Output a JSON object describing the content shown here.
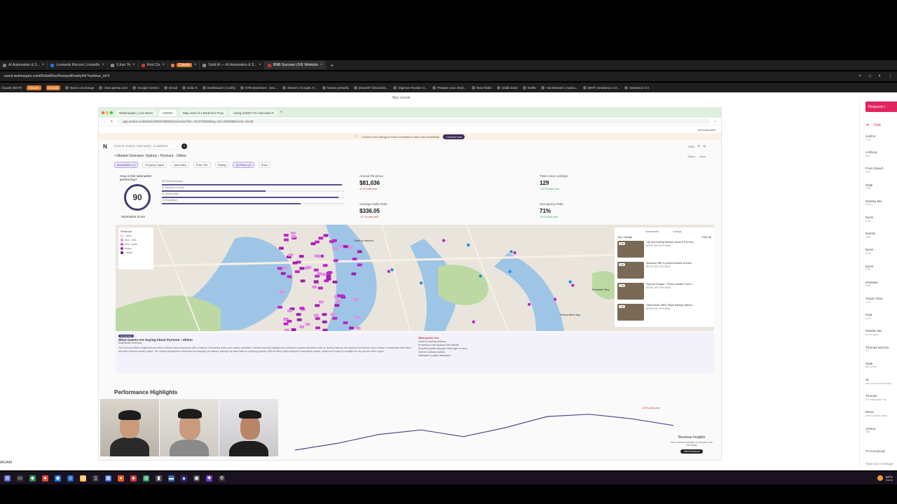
{
  "browser": {
    "tabs": [
      {
        "label": "AI Automation & S...",
        "color": "#7a7a7a"
      },
      {
        "label": "Leonardo Rinconi | LinkedIn",
        "color": "#2a6fd6"
      },
      {
        "label": "S.fran Yo",
        "color": "#888"
      },
      {
        "label": "Kimi Clo",
        "color": "#c0392b"
      },
      {
        "label": "Claude",
        "color": "#e07a2e"
      },
      {
        "label": "Solid AI — AI Automation & S...",
        "color": "#888"
      },
      {
        "label": "BNB Success LIVE Worksho",
        "color": "#c0392b"
      }
    ],
    "url": "event.webinarjam.com/t/ls0w8/live/5mmpx80xwhy/t4r?webinar_id=2",
    "bookmarks": [
      "Claude (MCP)",
      "Claude",
      "Claude",
      "Banco exchange",
      "chat.openai.com",
      "Google Gemini",
      "Gmail",
      "solid AI",
      "Dashboard | Coolify",
      "NTB Machines - Sea...",
      "Stream | Google AI...",
      "Nueva pestaña",
      "lyhack07 (leonardo...",
      "Digimon Rookie Ar...",
      "Prepare your 2022...",
      "New folder",
      "solids track",
      "Netflix",
      "HackStream | Aplica...",
      "(BKP) Seedance 2.0...",
      "seedance 2.0"
    ]
  },
  "share": {
    "label": "Mac cenvel",
    "tabs": [
      "Webinarjam | Live Strea",
      "AirDNA",
      "Map view of 2 Bedroom Prop",
      "Using AirDNA To Calculate R"
    ],
    "url": "app.airdna.co/data/au/30831/96862/overview?lat=-33.870252&lng=151.206208&zoom=15.58",
    "bookmarks_right": "All Bookmarks",
    "banner_text": "Connect your listings to track competitor's rates and availability",
    "banner_btn": "Connect now",
    "search_placeholder": "Search market, submarket, or address",
    "header_right": [
      "Help",
      "Account"
    ],
    "breadcrumb": "< Market Overview: Sydney  ›  Pyrmont - Ultimo",
    "crumb_actions": [
      "Share",
      "Save"
    ],
    "filters": [
      "Beds/Baths (1)",
      "Property Types",
      "Amenities",
      "Price Tier",
      "Rating",
      "All Filters (1)",
      "Save"
    ],
    "score": {
      "question": "How is this submarket performing?",
      "value": "90",
      "caption": "Submarket Score",
      "bars": [
        {
          "label": "99 Rental Demand",
          "fill": 0.99
        },
        {
          "label": "57 Revenue Growth",
          "fill": 0.57
        },
        {
          "label": "97 Seasonality",
          "fill": 0.97
        },
        {
          "label": "76 Regulation",
          "fill": 0.76
        }
      ]
    },
    "kpis": [
      {
        "label": "Annual Revenue",
        "value": "$81,036",
        "delta": "-8.9% past year",
        "up": false
      },
      {
        "label": "Average Daily Rate",
        "value": "$336.05",
        "delta": "-12.7% past year",
        "up": false
      },
      {
        "label": "Total Active Listings",
        "value": "129",
        "delta": "+43.5% past year",
        "up": true
      },
      {
        "label": "Occupancy Rate",
        "value": "71%",
        "delta": "+6.4% past year",
        "up": true
      }
    ],
    "map": {
      "legend_title": "Revenue",
      "legend_items": [
        "< $50K",
        "$50K - $75K",
        "$75K - $100K",
        "$100K+",
        "> $150K"
      ],
      "legend_colors": [
        "#f1c6f1",
        "#e18ee4",
        "#c94fd1",
        "#a01fb0",
        "#6a0a7a"
      ],
      "listings_tabs": [
        "Submarkets",
        "Listings"
      ],
      "listings_title": "Top Listings",
      "view_all": "View all",
      "listings": [
        {
          "title": "City and Darling Harbour views & Pool bre...",
          "meta": "$102K  353  81%  $384"
        },
        {
          "title": "Spacious 2BR in perfect location at Darli...",
          "meta": "$107K  353  74%  $413"
        },
        {
          "title": "Pyrmont Escape - Prime Location Pool a...",
          "meta": "$102K  350  75%  $394"
        },
        {
          "title": "Harbourside 2BR2 Steps Darling Harbour...",
          "meta": "$102K  340  79%  $409"
        }
      ],
      "add_label": "Add",
      "labels": [
        "Darling Harbour",
        "Elizabeth Bay",
        "Rushcutters Bay"
      ]
    },
    "insights": {
      "badge": "AI Overview",
      "title": "What Guests Are Saying About Pyrmont - Ultimo",
      "subtitle": "Submarket Overview",
      "paragraph": "The Pyrmont-Ultimo neighbourhood offers a vibrant urban experience with a balance of historical charm and modern amenities. Guests frequently highlight its proximity to popular attractions such as Darling Harbour, the Sydney Fish Market, and a variety of restaurants that reflect the area's diverse culinary scene. The overall atmosphere is described as energetic yet relaxed, making it an ideal base for exploring Sydney. With excellent public transport connections nearby, visitors find it easy to navigate the city and the wider region.",
      "side_title": "What guests love",
      "side_items": [
        "Close to Darling Harbour",
        "Proximity to the Sydney Fish Market",
        "Excellent public transport links right on area",
        "Diverse culinary options",
        "Walkable to major attractions"
      ]
    },
    "perf_title": "Performance Highlights",
    "perf_chart": {
      "values": [
        40,
        46,
        54,
        58,
        52,
        60,
        70,
        72,
        68,
        62
      ]
    },
    "perf_pct": "-8.9% past year",
    "rev_title": "Revenue Insights",
    "rev_sub": "See revenue estimates to compare with this listing",
    "rev_btn": "View Revenue"
  },
  "chat": {
    "request_btn": "Request t",
    "tabs": [
      "Chat",
      ""
    ],
    "messages": [
      {
        "name": "Justice",
        "text": "3.78"
      },
      {
        "name": "Anthony",
        "text": "83K"
      },
      {
        "name": "From Quach",
        "text": "22K"
      },
      {
        "name": "Shak",
        "text": "7.5K"
      },
      {
        "name": "Stanley Ma",
        "text": "oooo r"
      },
      {
        "name": "byron",
        "text": "5.3K"
      },
      {
        "name": "Darrell",
        "text": "4.8K"
      },
      {
        "name": "byron",
        "text": "3.2K"
      },
      {
        "name": "byron",
        "text": "5.1K"
      },
      {
        "name": "Khristine",
        "text": "8.6K"
      },
      {
        "name": "Travis Chea",
        "text": "3.7K"
      },
      {
        "name": "Kaat",
        "text": "4.2K"
      },
      {
        "name": "Stanley Ma",
        "text": "Lemongas"
      },
      {
        "name": "Thomas McCom",
        "text": "4.1"
      },
      {
        "name": "Shak",
        "text": "80K profit"
      },
      {
        "name": "ok",
        "text": "can you do McDonald"
      },
      {
        "name": "Thomas",
        "text": "It's telling with my"
      },
      {
        "name": "Elena",
        "text": "which Airdna plan?"
      },
      {
        "name": "Ashton",
        "text": "33K"
      }
    ],
    "to": "To Everybody",
    "type_placeholder": "Type your message"
  },
  "presenter_name": "ARJAM",
  "taskbar": {
    "weather": "24°C",
    "weather_sub": "Sunny"
  }
}
